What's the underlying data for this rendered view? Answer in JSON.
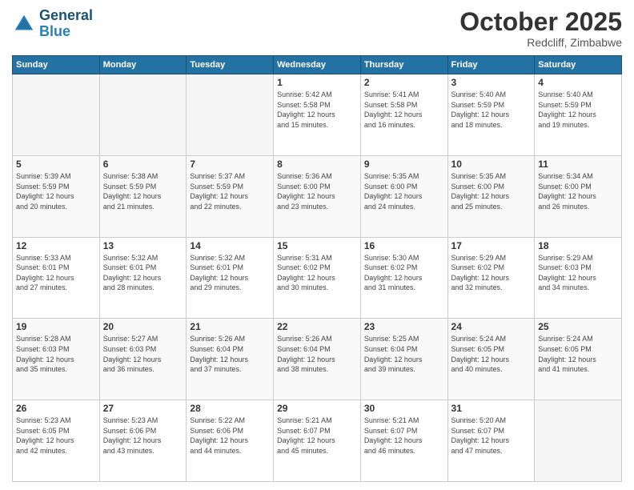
{
  "logo": {
    "line1": "General",
    "line2": "Blue"
  },
  "title": "October 2025",
  "location": "Redcliff, Zimbabwe",
  "header_days": [
    "Sunday",
    "Monday",
    "Tuesday",
    "Wednesday",
    "Thursday",
    "Friday",
    "Saturday"
  ],
  "weeks": [
    [
      {
        "day": "",
        "info": ""
      },
      {
        "day": "",
        "info": ""
      },
      {
        "day": "",
        "info": ""
      },
      {
        "day": "1",
        "info": "Sunrise: 5:42 AM\nSunset: 5:58 PM\nDaylight: 12 hours\nand 15 minutes."
      },
      {
        "day": "2",
        "info": "Sunrise: 5:41 AM\nSunset: 5:58 PM\nDaylight: 12 hours\nand 16 minutes."
      },
      {
        "day": "3",
        "info": "Sunrise: 5:40 AM\nSunset: 5:59 PM\nDaylight: 12 hours\nand 18 minutes."
      },
      {
        "day": "4",
        "info": "Sunrise: 5:40 AM\nSunset: 5:59 PM\nDaylight: 12 hours\nand 19 minutes."
      }
    ],
    [
      {
        "day": "5",
        "info": "Sunrise: 5:39 AM\nSunset: 5:59 PM\nDaylight: 12 hours\nand 20 minutes."
      },
      {
        "day": "6",
        "info": "Sunrise: 5:38 AM\nSunset: 5:59 PM\nDaylight: 12 hours\nand 21 minutes."
      },
      {
        "day": "7",
        "info": "Sunrise: 5:37 AM\nSunset: 5:59 PM\nDaylight: 12 hours\nand 22 minutes."
      },
      {
        "day": "8",
        "info": "Sunrise: 5:36 AM\nSunset: 6:00 PM\nDaylight: 12 hours\nand 23 minutes."
      },
      {
        "day": "9",
        "info": "Sunrise: 5:35 AM\nSunset: 6:00 PM\nDaylight: 12 hours\nand 24 minutes."
      },
      {
        "day": "10",
        "info": "Sunrise: 5:35 AM\nSunset: 6:00 PM\nDaylight: 12 hours\nand 25 minutes."
      },
      {
        "day": "11",
        "info": "Sunrise: 5:34 AM\nSunset: 6:00 PM\nDaylight: 12 hours\nand 26 minutes."
      }
    ],
    [
      {
        "day": "12",
        "info": "Sunrise: 5:33 AM\nSunset: 6:01 PM\nDaylight: 12 hours\nand 27 minutes."
      },
      {
        "day": "13",
        "info": "Sunrise: 5:32 AM\nSunset: 6:01 PM\nDaylight: 12 hours\nand 28 minutes."
      },
      {
        "day": "14",
        "info": "Sunrise: 5:32 AM\nSunset: 6:01 PM\nDaylight: 12 hours\nand 29 minutes."
      },
      {
        "day": "15",
        "info": "Sunrise: 5:31 AM\nSunset: 6:02 PM\nDaylight: 12 hours\nand 30 minutes."
      },
      {
        "day": "16",
        "info": "Sunrise: 5:30 AM\nSunset: 6:02 PM\nDaylight: 12 hours\nand 31 minutes."
      },
      {
        "day": "17",
        "info": "Sunrise: 5:29 AM\nSunset: 6:02 PM\nDaylight: 12 hours\nand 32 minutes."
      },
      {
        "day": "18",
        "info": "Sunrise: 5:29 AM\nSunset: 6:03 PM\nDaylight: 12 hours\nand 34 minutes."
      }
    ],
    [
      {
        "day": "19",
        "info": "Sunrise: 5:28 AM\nSunset: 6:03 PM\nDaylight: 12 hours\nand 35 minutes."
      },
      {
        "day": "20",
        "info": "Sunrise: 5:27 AM\nSunset: 6:03 PM\nDaylight: 12 hours\nand 36 minutes."
      },
      {
        "day": "21",
        "info": "Sunrise: 5:26 AM\nSunset: 6:04 PM\nDaylight: 12 hours\nand 37 minutes."
      },
      {
        "day": "22",
        "info": "Sunrise: 5:26 AM\nSunset: 6:04 PM\nDaylight: 12 hours\nand 38 minutes."
      },
      {
        "day": "23",
        "info": "Sunrise: 5:25 AM\nSunset: 6:04 PM\nDaylight: 12 hours\nand 39 minutes."
      },
      {
        "day": "24",
        "info": "Sunrise: 5:24 AM\nSunset: 6:05 PM\nDaylight: 12 hours\nand 40 minutes."
      },
      {
        "day": "25",
        "info": "Sunrise: 5:24 AM\nSunset: 6:05 PM\nDaylight: 12 hours\nand 41 minutes."
      }
    ],
    [
      {
        "day": "26",
        "info": "Sunrise: 5:23 AM\nSunset: 6:05 PM\nDaylight: 12 hours\nand 42 minutes."
      },
      {
        "day": "27",
        "info": "Sunrise: 5:23 AM\nSunset: 6:06 PM\nDaylight: 12 hours\nand 43 minutes."
      },
      {
        "day": "28",
        "info": "Sunrise: 5:22 AM\nSunset: 6:06 PM\nDaylight: 12 hours\nand 44 minutes."
      },
      {
        "day": "29",
        "info": "Sunrise: 5:21 AM\nSunset: 6:07 PM\nDaylight: 12 hours\nand 45 minutes."
      },
      {
        "day": "30",
        "info": "Sunrise: 5:21 AM\nSunset: 6:07 PM\nDaylight: 12 hours\nand 46 minutes."
      },
      {
        "day": "31",
        "info": "Sunrise: 5:20 AM\nSunset: 6:07 PM\nDaylight: 12 hours\nand 47 minutes."
      },
      {
        "day": "",
        "info": ""
      }
    ]
  ]
}
